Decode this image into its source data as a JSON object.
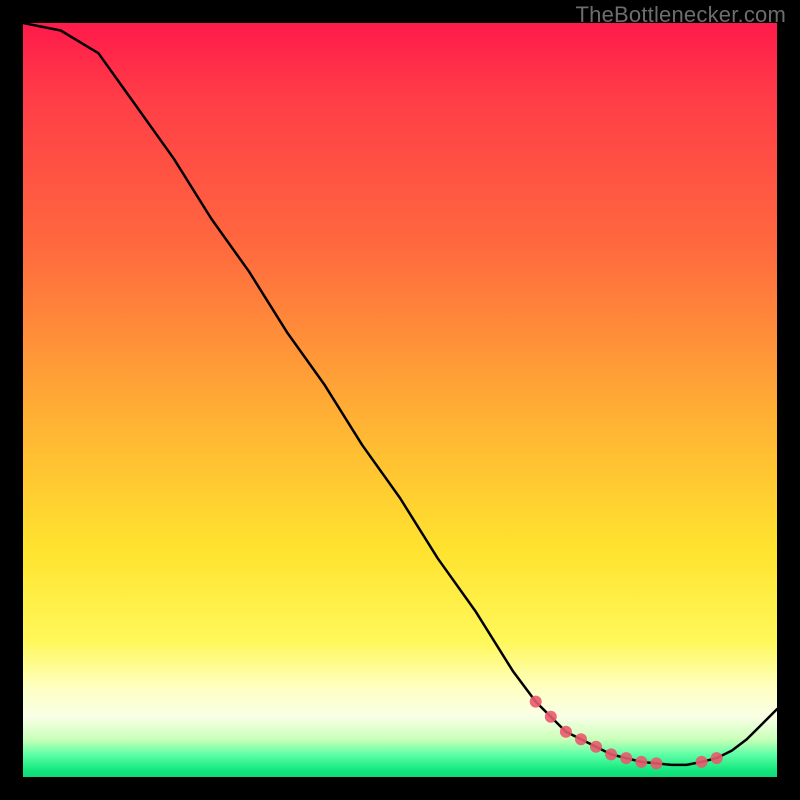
{
  "watermark": "TheBottlenecker.com",
  "chart_data": {
    "type": "line",
    "title": "",
    "xlabel": "",
    "ylabel": "",
    "xlim": [
      0,
      100
    ],
    "ylim": [
      0,
      100
    ],
    "x": [
      0,
      5,
      10,
      15,
      20,
      25,
      30,
      35,
      40,
      45,
      50,
      55,
      60,
      65,
      68,
      70,
      72,
      74,
      76,
      78,
      80,
      82,
      84,
      86,
      88,
      90,
      92,
      94,
      96,
      98,
      100
    ],
    "y": [
      100,
      99,
      96,
      89,
      82,
      74,
      67,
      59,
      52,
      44,
      37,
      29,
      22,
      14,
      10,
      8,
      6,
      5,
      4,
      3,
      2.5,
      2,
      1.8,
      1.6,
      1.6,
      2,
      2.5,
      3.5,
      5,
      7,
      9
    ],
    "markers": {
      "x": [
        68,
        70,
        72,
        74,
        76,
        78,
        80,
        82,
        84,
        90,
        92
      ],
      "y": [
        10,
        8,
        6,
        5,
        4,
        3,
        2.5,
        2,
        1.8,
        2,
        2.5
      ]
    }
  },
  "colors": {
    "curve": "#000000",
    "dots": "#e85a6d",
    "frame": "#000000"
  }
}
